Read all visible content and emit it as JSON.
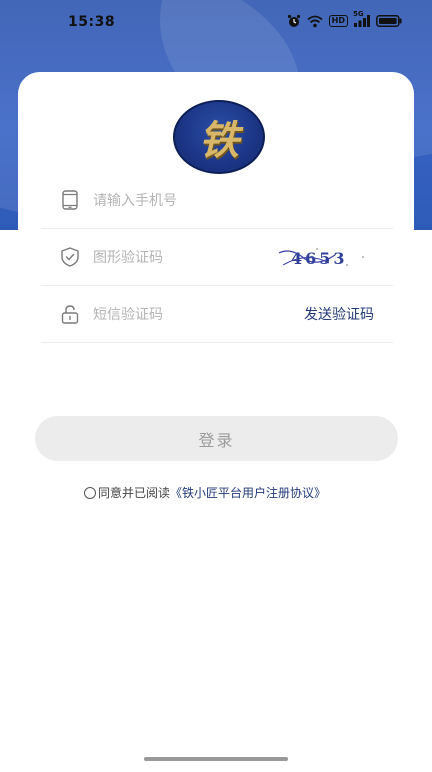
{
  "status_bar": {
    "time": "15:38",
    "icons": [
      "alarm-icon",
      "wifi-icon",
      "hd-icon",
      "signal-icon",
      "battery-icon"
    ],
    "hd_label": "HD",
    "network_label": "5G"
  },
  "logo": {
    "char": "铁"
  },
  "form": {
    "phone": {
      "placeholder": "请输入手机号",
      "icon": "phone-icon"
    },
    "captcha": {
      "placeholder": "图形验证码",
      "icon": "shield-check-icon",
      "captcha_text": "4653"
    },
    "sms": {
      "placeholder": "短信验证码",
      "icon": "lock-icon",
      "send_label": "发送验证码"
    }
  },
  "login_button": {
    "label": "登录"
  },
  "agreement": {
    "prefix": "同意并已阅读",
    "link": "《铁小匠平台用户注册协议》"
  },
  "colors": {
    "header_bg": "#3762c4",
    "link": "#233a78",
    "placeholder": "#b4b4b4",
    "button_bg": "#ececec"
  }
}
